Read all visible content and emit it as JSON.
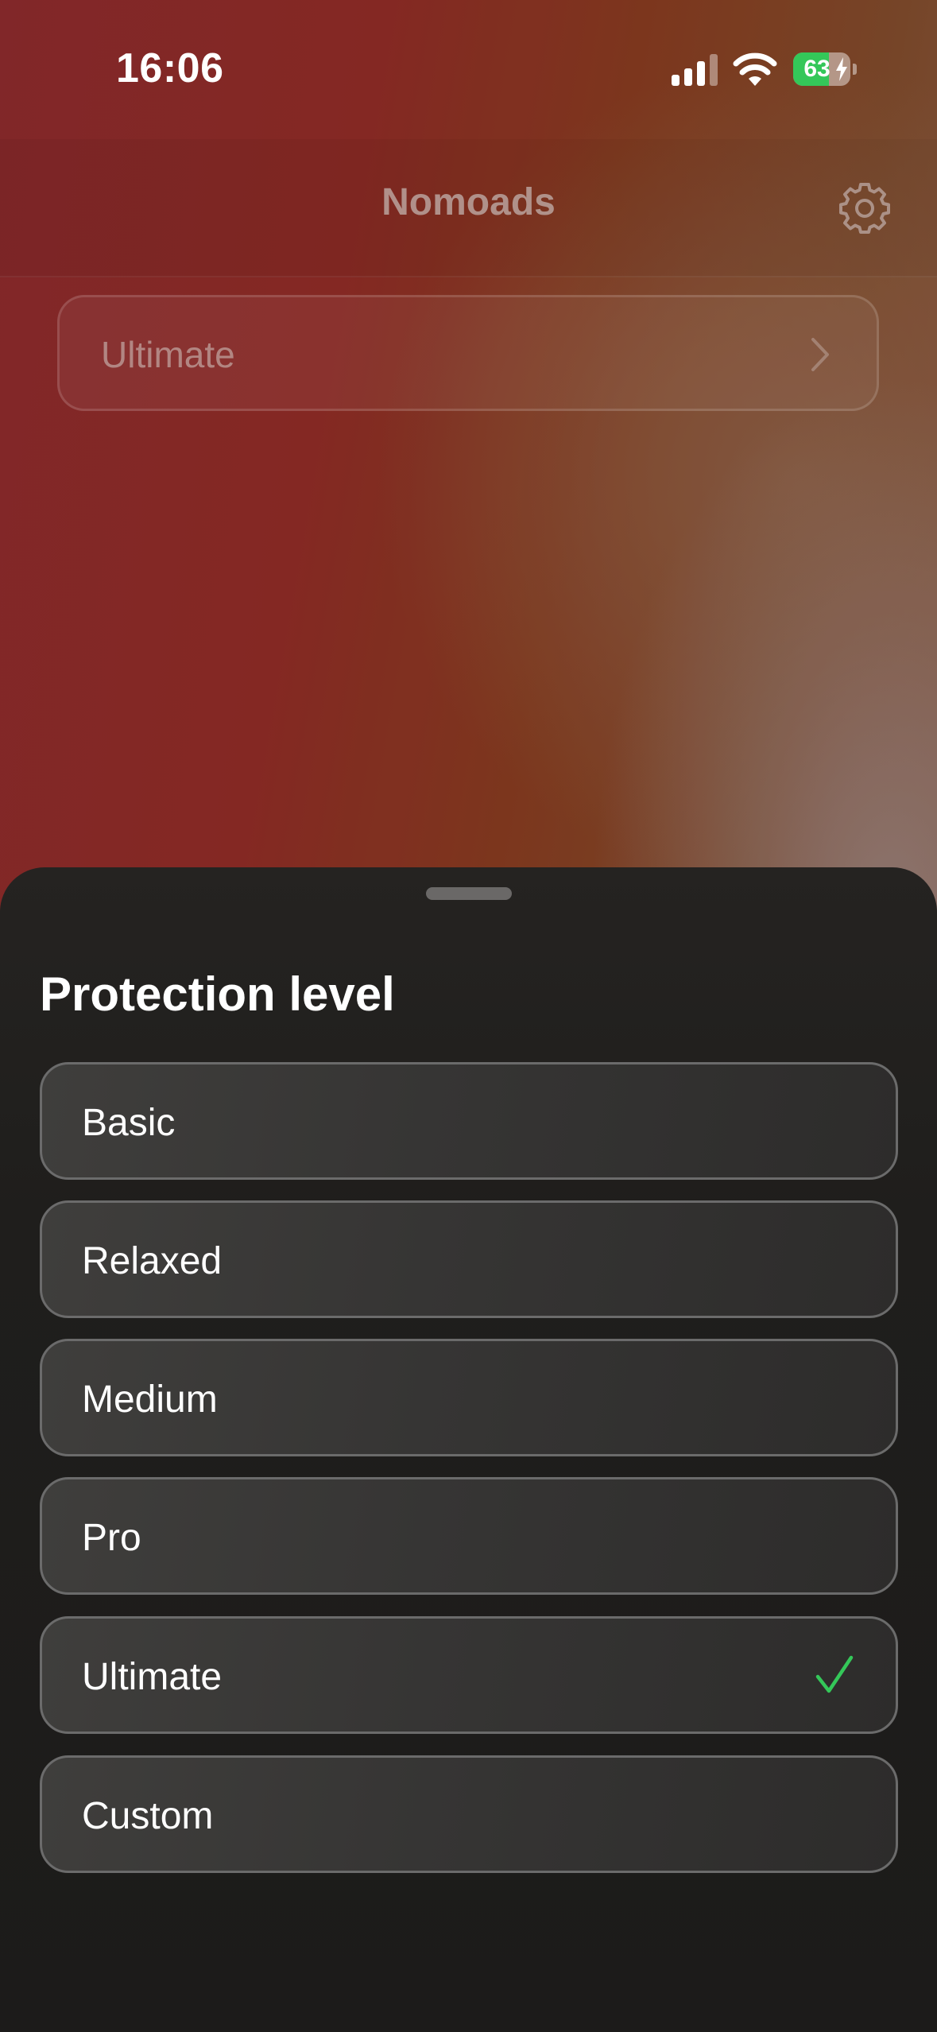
{
  "status_bar": {
    "time": "16:06",
    "battery_percent": "63",
    "battery_level": 0.63,
    "battery_charging": true,
    "icons": [
      "signal-icon",
      "wifi-icon",
      "battery-icon",
      "charging-bolt-icon"
    ]
  },
  "header": {
    "title": "Nomoads",
    "settings_icon": "gear-icon"
  },
  "level_selector": {
    "current_value": "Ultimate",
    "chevron_icon": "chevron-right-icon"
  },
  "sheet": {
    "title": "Protection level",
    "options": [
      {
        "label": "Basic",
        "selected": false
      },
      {
        "label": "Relaxed",
        "selected": false
      },
      {
        "label": "Medium",
        "selected": false
      },
      {
        "label": "Pro",
        "selected": false
      },
      {
        "label": "Ultimate",
        "selected": true
      },
      {
        "label": "Custom",
        "selected": false
      }
    ],
    "check_icon": "checkmark-icon"
  },
  "colors": {
    "check": "#34c759",
    "battery_fill": "#34c759",
    "sheet_background": "#1f1e1c",
    "option_border": "#6b6b6b"
  }
}
